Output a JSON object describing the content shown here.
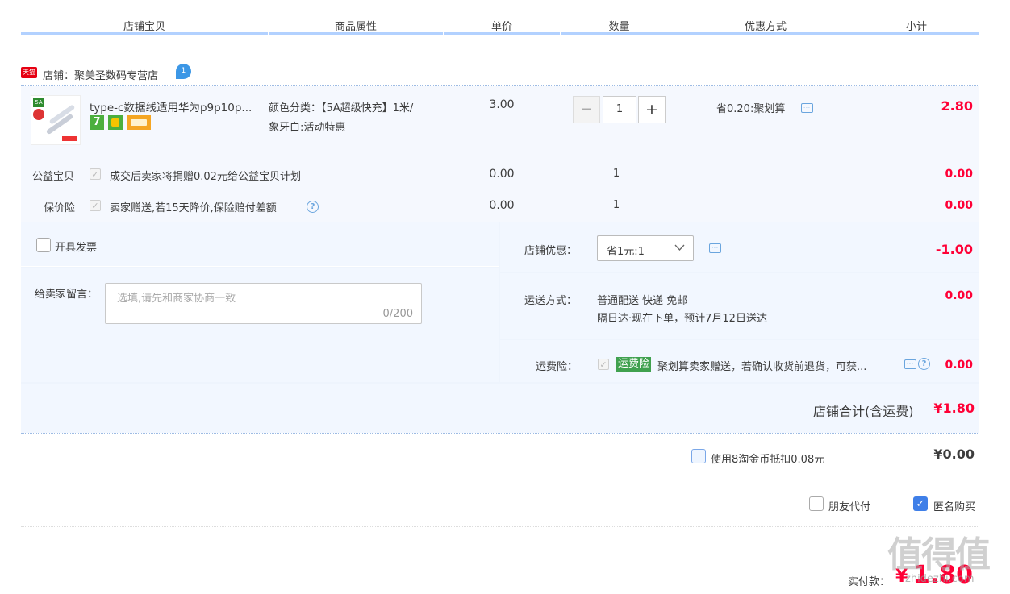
{
  "headers": {
    "store_item": "店铺宝贝",
    "attrs": "商品属性",
    "unit_price": "单价",
    "quantity": "数量",
    "discount": "优惠方式",
    "subtotal": "小计"
  },
  "shop": {
    "tmall_badge": "天猫",
    "label": "店铺：聚美圣数码专营店"
  },
  "product": {
    "title": "type-c数据线适用华为p9p10p...",
    "badge_5a": "5A",
    "badge_7": "7",
    "attr_line1": "颜色分类：【5A超级快充】1米/",
    "attr_line2": "象牙白:活动特惠",
    "price": "3.00",
    "qty": "1",
    "minus": "−",
    "plus": "+",
    "discount": "省0.20:聚划算",
    "subtotal": "2.80"
  },
  "charity": {
    "label": "公益宝贝",
    "text": "成交后卖家将捐赠0.02元给公益宝贝计划",
    "price": "0.00",
    "qty": "1",
    "subtotal": "0.00"
  },
  "insurance": {
    "label": "保价险",
    "text": "卖家赠送,若15天降价,保险赔付差额",
    "price": "0.00",
    "qty": "1",
    "subtotal": "0.00"
  },
  "invoice": {
    "label": "开具发票"
  },
  "message": {
    "label": "给卖家留言：",
    "placeholder": "选填,请先和商家协商一致",
    "counter": "0/200"
  },
  "shop_discount": {
    "label": "店铺优惠：",
    "selected": "省1元:1",
    "amount": "-1.00"
  },
  "shipping": {
    "label": "运送方式：",
    "line1": "普通配送 快递 免邮",
    "line2": "隔日达·现在下单，预计7月12日送达",
    "amount": "0.00"
  },
  "freight_ins": {
    "label": "运费险：",
    "tag": "运费险",
    "text": "聚划算卖家赠送，若确认收货前退货，可获...",
    "amount": "0.00"
  },
  "shop_total": {
    "label": "店铺合计(含运费)",
    "amount": "¥1.80"
  },
  "coins": {
    "label": "使用8淘金币抵扣0.08元",
    "amount": "¥0.00"
  },
  "options": {
    "friend_pay": "朋友代付",
    "anonymous": "匿名购买"
  },
  "payment": {
    "label": "实付款：",
    "currency": "¥",
    "amount": "1.80"
  },
  "watermark": {
    "text": "值得值",
    "url": "zhidezhi.com"
  },
  "colors": {
    "accent_red": "#ff0036",
    "header_bar": "#b2d1ff",
    "row_bg": "#f2f7ff"
  }
}
